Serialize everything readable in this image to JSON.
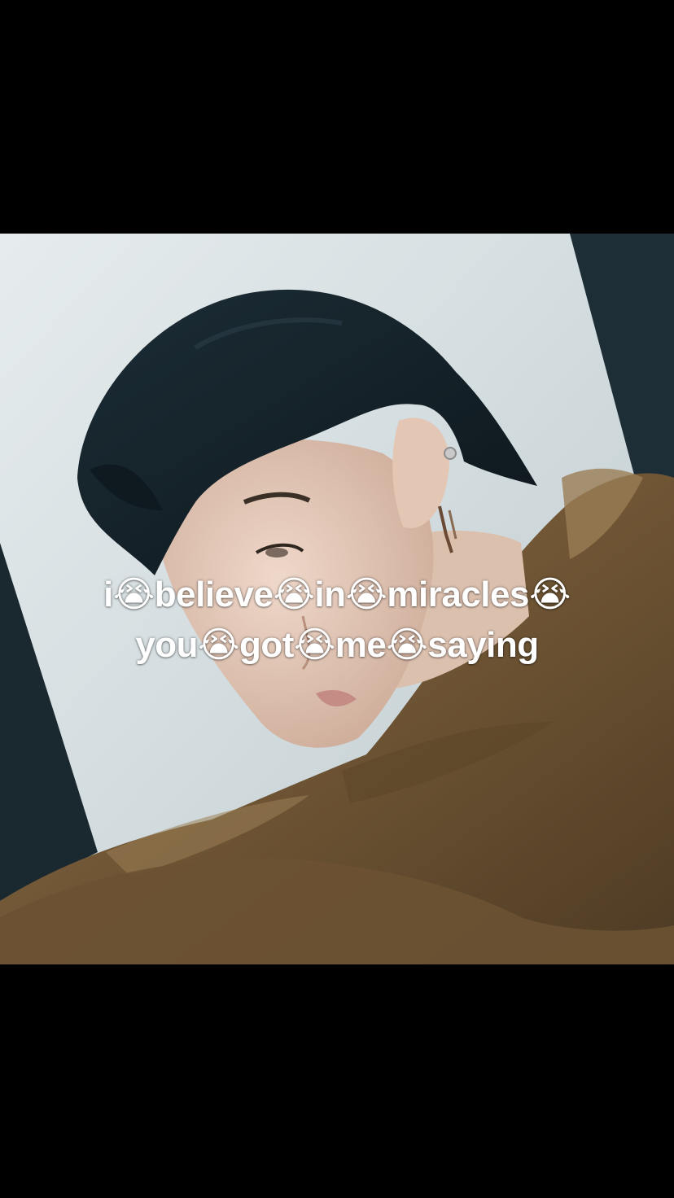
{
  "video": {
    "caption_lines": [
      "i😭believe😭in😭miracles😭",
      "you😭got😭me😭saying"
    ]
  },
  "colors": {
    "letterbox": "#000000",
    "backdrop_light": "#d8dfe1",
    "backdrop_dark": "#1b2b33",
    "hair": "#15222a",
    "skin": "#e7cdbd",
    "jacket": "#7a5f3d",
    "caption_text": "#ffffff"
  }
}
